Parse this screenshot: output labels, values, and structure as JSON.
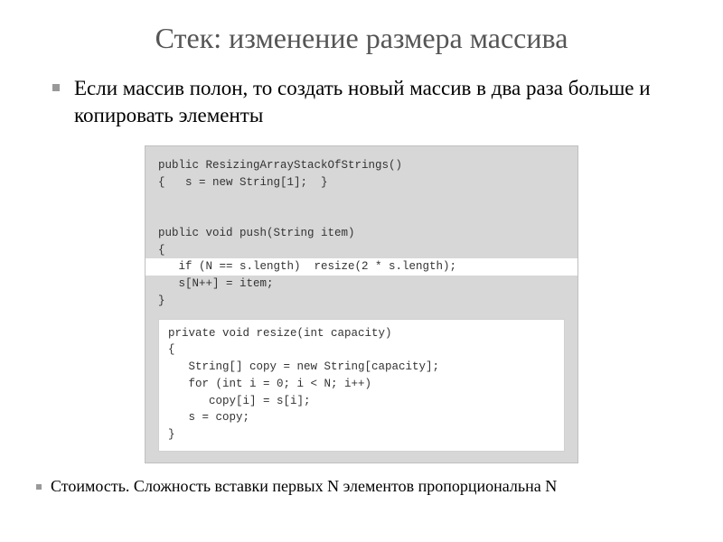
{
  "title": "Стек: изменение размера массива",
  "bullet1": "Если массив полон, то создать новый массив в два раза больше и копировать элементы",
  "code": {
    "l1": "public ResizingArrayStackOfStrings()",
    "l2": "{   s = new String[1];  }",
    "l3": "public void push(String item)",
    "l4": "{",
    "l5": "   if (N == s.length)  resize(2 * s.length);",
    "l6": "   s[N++] = item;",
    "l7": "}"
  },
  "sub": {
    "s1": "private void resize(int capacity)",
    "s2": "{",
    "s3": "   String[] copy = new String[capacity];",
    "s4": "   for (int i = 0; i < N; i++)",
    "s5": "      copy[i] = s[i];",
    "s6": "   s = copy;",
    "s7": "}"
  },
  "bullet2": "Стоимость. Сложность вставки первых N элементов пропорциональна N"
}
